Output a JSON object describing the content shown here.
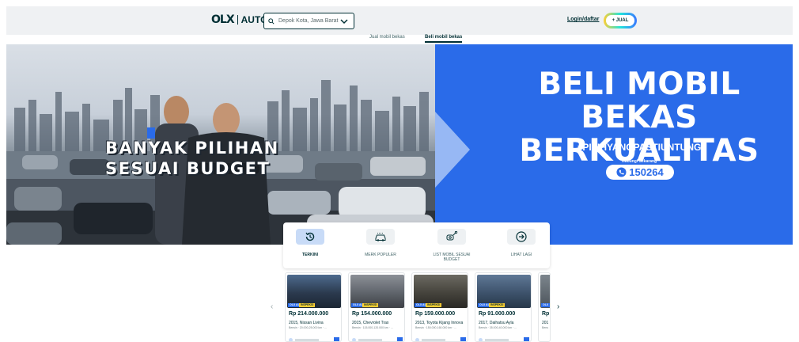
{
  "header": {
    "brand": "OLX",
    "brand_sub": "AUTOS",
    "location": "Depok Kota, Jawa Barat",
    "login_label": "Login/daftar",
    "sell_label": "+ JUAL"
  },
  "subtabs": [
    {
      "label": "Jual mobil bekas",
      "active": false
    },
    {
      "label": "Beli mobil bekas",
      "active": true
    }
  ],
  "banner": {
    "photo_line1": "BANYAK PILIHAN",
    "photo_line2": "SESUAI BUDGET",
    "headline_line1": "BELI MOBIL BEKAS",
    "headline_line2": "BERKUALITAS",
    "hashtag": "#PILIHYANGPASTIUNTUNG",
    "contact_label": "Hubungi Sekarang",
    "phone": "150264",
    "colors": {
      "panel": "#2a6be9",
      "phone_text": "#2a6be9"
    }
  },
  "categories": [
    {
      "label": "TERKINI",
      "icon": "history-icon",
      "active": true
    },
    {
      "label": "MERK POPULER",
      "icon": "car-icon",
      "active": false
    },
    {
      "label": "LIST MOBIL SESUAI BUDGET",
      "icon": "car-key-icon",
      "active": false
    },
    {
      "label": "LIHAT LAGI",
      "icon": "arrow-right-circle-icon",
      "active": false
    }
  ],
  "listings": [
    {
      "price": "Rp 214.000.000",
      "title": "2015, Nissan Livina",
      "meta": "Bensin · 20.000-25.000 km · ...",
      "tag1": "OLX AUTOS",
      "tag2": "INSPEKSI"
    },
    {
      "price": "Rp 154.000.000",
      "title": "2015, Chevrolet Trax",
      "meta": "Bensin · 115.000-120.000 km · ...",
      "tag1": "OLX AUTOS",
      "tag2": "INSPEKSI"
    },
    {
      "price": "Rp 159.000.000",
      "title": "2013, Toyota Kijang Innova",
      "meta": "Bensin · 150.000-160.000 km · ...",
      "tag1": "OLX AUTOS",
      "tag2": "INSPEKSI"
    },
    {
      "price": "Rp 91.000.000",
      "title": "2017, Daihatsu Ayla",
      "meta": "Bensin · 35.000-40.000 km · ...",
      "tag1": "OLX AUTOS",
      "tag2": "INSPEKSI"
    },
    {
      "price": "Rp",
      "title": "201",
      "meta": "Bens",
      "tag1": "OLX",
      "tag2": ""
    }
  ],
  "carousel_nav": {
    "prev": "‹",
    "next": "›"
  }
}
